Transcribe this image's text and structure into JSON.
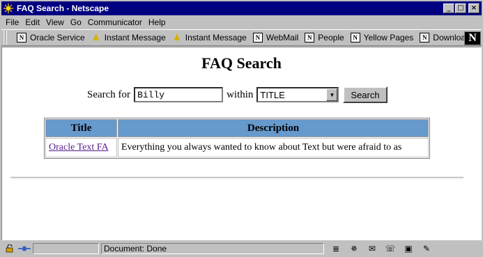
{
  "window": {
    "title": "FAQ Search - Netscape"
  },
  "menu": [
    "File",
    "Edit",
    "View",
    "Go",
    "Communicator",
    "Help"
  ],
  "toolbar": {
    "items": [
      {
        "label": "Oracle Service",
        "icon": "netscape-n-icon"
      },
      {
        "label": "Instant Message",
        "icon": "person-icon"
      },
      {
        "label": "Instant Message",
        "icon": "person-icon"
      },
      {
        "label": "WebMail",
        "icon": "netscape-n-icon"
      },
      {
        "label": "People",
        "icon": "netscape-n-icon"
      },
      {
        "label": "Yellow Pages",
        "icon": "netscape-n-icon"
      },
      {
        "label": "Download",
        "icon": "netscape-n-icon"
      }
    ]
  },
  "page": {
    "title": "FAQ Search",
    "search_label": "Search for",
    "search_value": "Billy",
    "within_label": "within",
    "within_value": "TITLE",
    "search_button": "Search",
    "table": {
      "headers": [
        "Title",
        "Description"
      ],
      "rows": [
        {
          "title": "Oracle Text FA",
          "description": "Everything you always wanted to know about Text but were afraid to as"
        }
      ]
    }
  },
  "status": {
    "text": "Document: Done"
  }
}
